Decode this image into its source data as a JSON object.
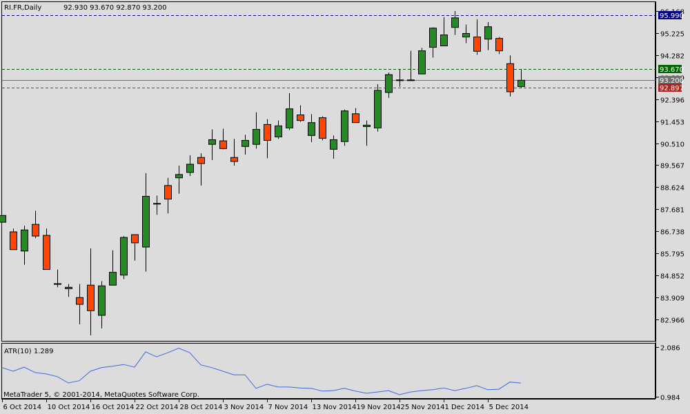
{
  "header": {
    "symbol": "RI.FR,Daily",
    "ohlc": "92.930 93.670 92.870 93.200"
  },
  "colors": {
    "background": "#dcdcdc",
    "bull": "#228b22",
    "bear": "#ff4500",
    "atr_line": "#4169e1",
    "ask_line": "#00008b",
    "high_line": "#008000",
    "last_line": "#707070",
    "bid_line": "#c81e1e"
  },
  "price_lines": [
    {
      "name": "ask",
      "value": 95.99,
      "label": "95.990",
      "color": "#000080",
      "style": "dashed"
    },
    {
      "name": "high",
      "value": 93.67,
      "label": "93.670",
      "color": "#006400",
      "style": "dashed"
    },
    {
      "name": "last",
      "value": 93.2,
      "label": "93.200",
      "color": "#707070",
      "style": "solid"
    },
    {
      "name": "bid",
      "value": 92.897,
      "label": "92.897",
      "color": "#b22222",
      "style": "dashed"
    }
  ],
  "indicator": {
    "label": "ATR(10) 1.289",
    "ticks": [
      "2.086",
      "0.984"
    ],
    "tick_values": [
      2.086,
      0.984
    ],
    "ylim": [
      0.938,
      2.177
    ],
    "values": [
      1.63,
      1.55,
      1.64,
      1.52,
      1.49,
      1.43,
      1.29,
      1.34,
      1.55,
      1.63,
      1.66,
      1.7,
      1.64,
      1.98,
      1.87,
      1.96,
      2.06,
      1.96,
      1.69,
      1.63,
      1.55,
      1.47,
      1.47,
      1.17,
      1.26,
      1.2,
      1.2,
      1.18,
      1.17,
      1.11,
      1.12,
      1.17,
      1.11,
      1.06,
      1.09,
      1.12,
      1.03,
      1.09,
      1.12,
      1.14,
      1.18,
      1.12,
      1.17,
      1.23,
      1.14,
      1.15,
      1.31,
      1.289
    ]
  },
  "copyright": "MetaTrader 5, © 2001-2014, MetaQuotes Software Corp.",
  "chart_data": {
    "type": "candlestick",
    "title": "RI.FR,Daily",
    "ylim": [
      82.059,
      96.632
    ],
    "y_ticks": [
      "96.168",
      "95.225",
      "94.282",
      "93.339",
      "92.396",
      "91.453",
      "90.510",
      "89.567",
      "88.624",
      "87.681",
      "86.738",
      "85.795",
      "84.852",
      "83.909",
      "82.966"
    ],
    "x_ticks": [
      {
        "index": 0,
        "label": "6 Oct 2014"
      },
      {
        "index": 4,
        "label": "10 Oct 2014"
      },
      {
        "index": 8,
        "label": "16 Oct 2014"
      },
      {
        "index": 12,
        "label": "22 Oct 2014"
      },
      {
        "index": 16,
        "label": "28 Oct 2014"
      },
      {
        "index": 20,
        "label": "3 Nov 2014"
      },
      {
        "index": 24,
        "label": "7 Nov 2014"
      },
      {
        "index": 28,
        "label": "13 Nov 2014"
      },
      {
        "index": 32,
        "label": "19 Nov 2014"
      },
      {
        "index": 36,
        "label": "25 Nov 2014"
      },
      {
        "index": 40,
        "label": "1 Dec 2014"
      },
      {
        "index": 44,
        "label": "5 Dec 2014"
      }
    ],
    "ohlc": [
      [
        87.13,
        87.42,
        87.13,
        87.42
      ],
      [
        86.72,
        86.86,
        85.96,
        85.96
      ],
      [
        85.9,
        86.98,
        85.31,
        86.8
      ],
      [
        87.04,
        87.62,
        86.45,
        86.54
      ],
      [
        86.57,
        86.86,
        85.11,
        85.11
      ],
      [
        84.49,
        85.11,
        84.35,
        84.49
      ],
      [
        84.29,
        84.49,
        83.94,
        84.35
      ],
      [
        83.91,
        84.49,
        82.77,
        83.62
      ],
      [
        84.44,
        86.01,
        82.3,
        83.35
      ],
      [
        83.15,
        84.61,
        82.59,
        84.41
      ],
      [
        84.44,
        85.93,
        84.44,
        84.99
      ],
      [
        84.87,
        86.54,
        84.7,
        86.48
      ],
      [
        86.6,
        86.6,
        85.49,
        86.25
      ],
      [
        86.07,
        89.23,
        85.02,
        88.24
      ],
      [
        87.92,
        88.27,
        87.45,
        87.92
      ],
      [
        88.7,
        89.03,
        87.51,
        88.12
      ],
      [
        89.03,
        89.55,
        88.35,
        89.17
      ],
      [
        89.26,
        89.99,
        89.11,
        89.61
      ],
      [
        89.9,
        90.08,
        88.7,
        89.64
      ],
      [
        90.46,
        91.1,
        89.79,
        90.66
      ],
      [
        90.61,
        91.13,
        90.25,
        90.28
      ],
      [
        89.9,
        90.69,
        89.55,
        89.73
      ],
      [
        90.37,
        90.87,
        90.02,
        90.63
      ],
      [
        90.46,
        91.83,
        90.28,
        91.1
      ],
      [
        91.31,
        91.54,
        89.87,
        90.63
      ],
      [
        90.78,
        91.48,
        90.69,
        91.25
      ],
      [
        91.16,
        92.65,
        91.07,
        91.98
      ],
      [
        91.72,
        92.13,
        91.42,
        91.48
      ],
      [
        90.84,
        91.75,
        90.55,
        91.39
      ],
      [
        91.6,
        91.66,
        90.63,
        90.72
      ],
      [
        90.25,
        90.84,
        89.85,
        90.66
      ],
      [
        90.58,
        91.95,
        90.4,
        91.89
      ],
      [
        91.77,
        92.01,
        91.39,
        91.39
      ],
      [
        91.22,
        91.48,
        90.4,
        91.28
      ],
      [
        91.16,
        93.03,
        91.01,
        92.77
      ],
      [
        92.68,
        93.53,
        92.45,
        93.44
      ],
      [
        93.2,
        93.67,
        92.92,
        93.2
      ],
      [
        93.2,
        94.46,
        93.2,
        93.2
      ],
      [
        93.47,
        94.58,
        93.47,
        94.46
      ],
      [
        94.61,
        95.46,
        94.17,
        95.43
      ],
      [
        94.67,
        95.9,
        94.67,
        95.14
      ],
      [
        95.46,
        96.16,
        95.14,
        95.87
      ],
      [
        95.05,
        95.58,
        94.79,
        95.2
      ],
      [
        95.05,
        95.81,
        94.29,
        94.44
      ],
      [
        94.96,
        95.69,
        94.49,
        95.49
      ],
      [
        94.99,
        95.05,
        94.32,
        94.46
      ],
      [
        93.91,
        94.26,
        92.51,
        92.71
      ],
      [
        92.93,
        93.67,
        92.87,
        93.2
      ]
    ]
  }
}
